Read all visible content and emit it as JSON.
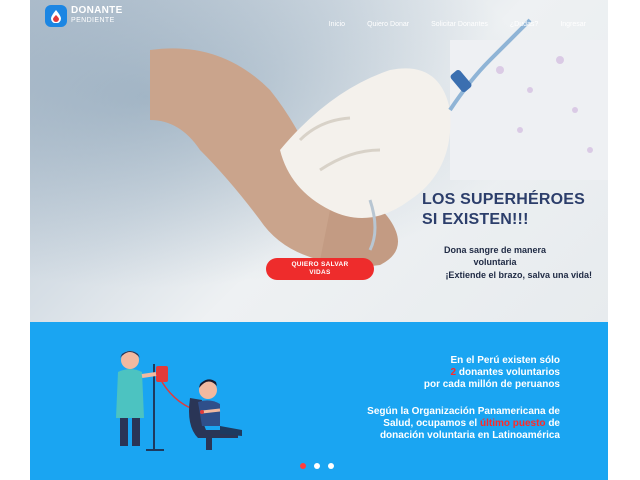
{
  "brand": {
    "line1": "DONANTE",
    "line2": "PENDIENTE"
  },
  "nav": {
    "items": [
      "Inicio",
      "Quiero Donar",
      "Solicitar Donantes",
      "¿Dudas?",
      "Ingresar"
    ]
  },
  "hero": {
    "title_line1": "LOS SUPERHÉROES",
    "title_line2": "SI EXISTEN!!!",
    "subtitle_line1": "Dona sangre de manera",
    "subtitle_line2": "voluntaria",
    "subtitle_line3": "¡Extiende el brazo, salva una vida!",
    "cta_line1": "QUIERO SALVAR",
    "cta_line2": "VIDAS"
  },
  "info": {
    "stat_line1": "En el Perú existen sólo",
    "stat_number": "2",
    "stat_line2_rest": " donantes voluntarios",
    "stat_line3": "por cada millón de peruanos",
    "ops_line1": "Según la Organización Panamericana de",
    "ops_line2_a": "Salud, ocupamos el ",
    "ops_line2_highlight": "último puesto",
    "ops_line2_b": " de",
    "ops_line3": "donación voluntaria en Latinoamérica"
  },
  "carousel": {
    "count": 3,
    "active_index": 0
  },
  "colors": {
    "brand_blue": "#1c86e3",
    "section_blue": "#1aa5f2",
    "cta_red": "#ee2c2c",
    "highlight_red": "#ff2a2a",
    "title_navy": "#2c3e6b"
  }
}
